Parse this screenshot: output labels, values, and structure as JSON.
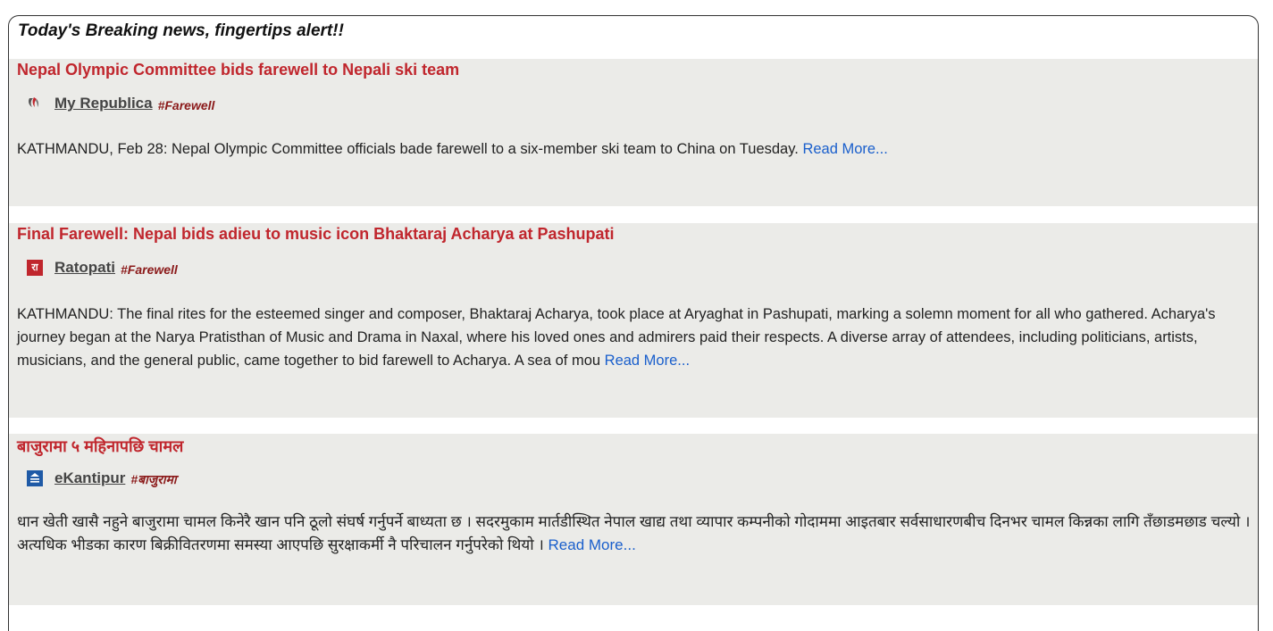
{
  "panel": {
    "title": "Today's Breaking news, fingertips alert!!"
  },
  "articles": [
    {
      "headline": "Nepal Olympic Committee bids farewell to Nepali ski team",
      "source": "My Republica",
      "source_icon": "republica-logo-icon",
      "tag": "#Farewell",
      "summary": "KATHMANDU, Feb 28: Nepal Olympic Committee officials bade farewell to a six-member ski team to China on Tuesday.",
      "read_more": "Read More..."
    },
    {
      "headline": "Final Farewell: Nepal bids adieu to music icon Bhaktaraj Acharya at Pashupati",
      "source": "Ratopati",
      "source_icon": "ratopati-logo-icon",
      "logo_text": "रा",
      "tag": "#Farewell",
      "summary": "KATHMANDU: The final rites for the esteemed singer and composer, Bhaktaraj Acharya, took place at Aryaghat in Pashupati, marking a solemn moment for all who gathered. Acharya's journey began at the Narya Pratisthan of Music and Drama in Naxal, where his loved ones and admirers paid their respects. A diverse array of attendees, including politicians, artists, musicians, and the general public, came together to bid farewell to Acharya. A sea of mou",
      "read_more": "Read More..."
    },
    {
      "headline": "बाजुरामा ५ महिनापछि चामल",
      "source": "eKantipur",
      "source_icon": "ekantipur-logo-icon",
      "tag": "#बाजुरामा",
      "summary": "धान खेती खासै नहुने बाजुरामा चामल किनेरै खान पनि ठूलो संघर्ष गर्नुपर्ने बाध्यता छ । सदरमुकाम मार्तडीस्थित नेपाल खाद्य तथा व्यापार कम्पनीको गोदाममा आइतबार सर्वसाधारणबीच दिनभर चामल किन्नका लागि तँछाडमछाड चल्यो । अत्यधिक भीडका कारण बिक्रीवितरणमा समस्या आएपछि सुरक्षाकर्मी नै परिचालन गर्नुपरेको थियो ।",
      "read_more": "Read More..."
    }
  ],
  "colors": {
    "headline": "#c0262d",
    "card_background": "#ebebe8",
    "link": "#1a5fcc",
    "tag": "#8b1a1a"
  }
}
